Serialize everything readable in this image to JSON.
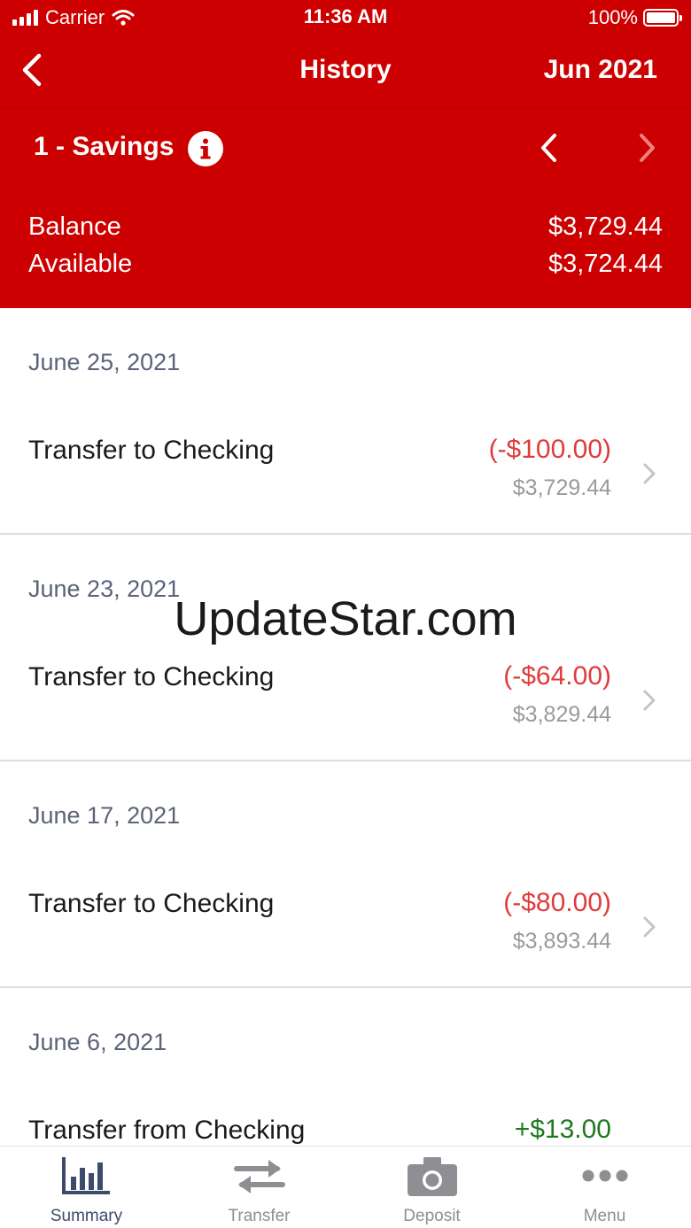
{
  "status_bar": {
    "carrier": "Carrier",
    "time": "11:36 AM",
    "battery": "100%"
  },
  "nav": {
    "title": "History",
    "month": "Jun 2021"
  },
  "account": {
    "name": "1 - Savings"
  },
  "summary": {
    "balance_label": "Balance",
    "balance_value": "$3,729.44",
    "available_label": "Available",
    "available_value": "$3,724.44"
  },
  "sections": [
    {
      "date": "June 25, 2021",
      "transactions": [
        {
          "description": "Transfer to Checking",
          "amount": "(-$100.00)",
          "running_balance": "$3,729.44"
        }
      ]
    },
    {
      "date": "June 23, 2021",
      "transactions": [
        {
          "description": "Transfer to Checking",
          "amount": "(-$64.00)",
          "running_balance": "$3,829.44"
        }
      ]
    },
    {
      "date": "June 17, 2021",
      "transactions": [
        {
          "description": "Transfer to Checking",
          "amount": "(-$80.00)",
          "running_balance": "$3,893.44"
        }
      ]
    },
    {
      "date": "June 6, 2021",
      "transactions": [
        {
          "description": "Transfer from Checking",
          "amount": "+$13.00"
        }
      ]
    }
  ],
  "watermark": "UpdateStar.com",
  "tabs": [
    {
      "label": "Summary",
      "icon": "bar-chart-icon",
      "active": true
    },
    {
      "label": "Transfer",
      "icon": "transfer-arrows-icon"
    },
    {
      "label": "Deposit",
      "icon": "camera-icon"
    },
    {
      "label": "Menu",
      "icon": "more-dots-icon"
    }
  ],
  "colors": {
    "brand_red": "#cc0000",
    "debit_red": "#e03b3b",
    "credit_green": "#1e7a1e",
    "date_gray": "#5b6378",
    "tab_active": "#3c4a6b",
    "tab_inactive": "#8e8e93"
  }
}
